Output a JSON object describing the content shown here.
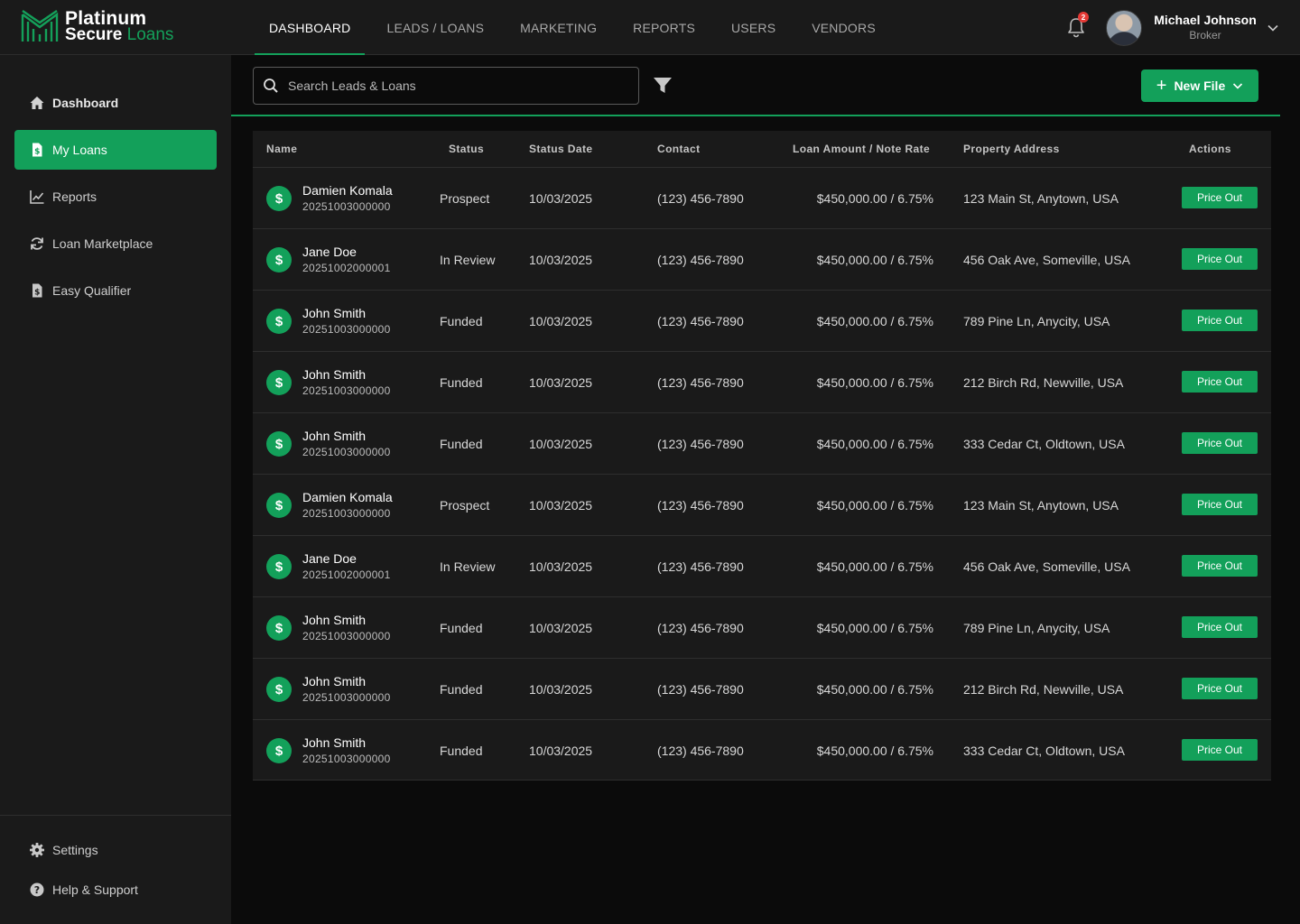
{
  "brand": {
    "line1": "Platinum",
    "line2_a": "Secure",
    "line2_b": "Loans",
    "accent": "#13a05a"
  },
  "nav": [
    {
      "label": "DASHBOARD",
      "active": true
    },
    {
      "label": "LEADS / LOANS"
    },
    {
      "label": "MARKETING"
    },
    {
      "label": "REPORTS"
    },
    {
      "label": "USERS"
    },
    {
      "label": "VENDORS"
    }
  ],
  "notifications": {
    "count": "2",
    "icon": "bell-icon"
  },
  "user": {
    "name": "Michael Johnson",
    "role": "Broker"
  },
  "sidebar": {
    "items": [
      {
        "label": "Dashboard",
        "icon": "home-icon"
      },
      {
        "label": "My Loans",
        "icon": "document-dollar-icon",
        "active": true
      },
      {
        "label": "Reports",
        "icon": "chart-line-icon"
      },
      {
        "label": "Loan Marketplace",
        "icon": "refresh-icon"
      },
      {
        "label": "Easy Qualifier",
        "icon": "document-dollar-icon"
      }
    ],
    "bottom": [
      {
        "label": "Settings",
        "icon": "gear-icon"
      },
      {
        "label": "Help & Support",
        "icon": "help-icon"
      }
    ]
  },
  "search": {
    "placeholder": "Search Leads & Loans",
    "value": ""
  },
  "toolbar": {
    "new_file_label": "New File"
  },
  "table": {
    "columns": [
      "Name",
      "Status",
      "Status Date",
      "Contact",
      "Loan Amount / Note Rate",
      "Property Address",
      "Actions"
    ],
    "rows": [
      {
        "name": "Damien Komala",
        "id": "20251003000000",
        "status": "Prospect",
        "date": "10/03/2025",
        "contact": "(123) 456-7890",
        "amount": "$450,000.00 / 6.75%",
        "address": "123 Main St, Anytown, USA",
        "action": "Price Out"
      },
      {
        "name": "Jane Doe",
        "id": "20251002000001",
        "status": "In Review",
        "date": "10/03/2025",
        "contact": "(123) 456-7890",
        "amount": "$450,000.00 / 6.75%",
        "address": "456 Oak Ave, Someville, USA",
        "action": "Price Out"
      },
      {
        "name": "John Smith",
        "id": "20251003000000",
        "status": "Funded",
        "date": "10/03/2025",
        "contact": "(123) 456-7890",
        "amount": "$450,000.00 / 6.75%",
        "address": "789 Pine Ln, Anycity, USA",
        "action": "Price Out"
      },
      {
        "name": "John Smith",
        "id": "20251003000000",
        "status": "Funded",
        "date": "10/03/2025",
        "contact": "(123) 456-7890",
        "amount": "$450,000.00 / 6.75%",
        "address": "212 Birch Rd, Newville, USA",
        "action": "Price Out"
      },
      {
        "name": "John Smith",
        "id": "20251003000000",
        "status": "Funded",
        "date": "10/03/2025",
        "contact": "(123) 456-7890",
        "amount": "$450,000.00 / 6.75%",
        "address": "333 Cedar Ct, Oldtown, USA",
        "action": "Price Out"
      },
      {
        "name": "Damien Komala",
        "id": "20251003000000",
        "status": "Prospect",
        "date": "10/03/2025",
        "contact": "(123) 456-7890",
        "amount": "$450,000.00 / 6.75%",
        "address": "123 Main St, Anytown, USA",
        "action": "Price Out"
      },
      {
        "name": "Jane Doe",
        "id": "20251002000001",
        "status": "In Review",
        "date": "10/03/2025",
        "contact": "(123) 456-7890",
        "amount": "$450,000.00 / 6.75%",
        "address": "456 Oak Ave, Someville, USA",
        "action": "Price Out"
      },
      {
        "name": "John Smith",
        "id": "20251003000000",
        "status": "Funded",
        "date": "10/03/2025",
        "contact": "(123) 456-7890",
        "amount": "$450,000.00 / 6.75%",
        "address": "789 Pine Ln, Anycity, USA",
        "action": "Price Out"
      },
      {
        "name": "John Smith",
        "id": "20251003000000",
        "status": "Funded",
        "date": "10/03/2025",
        "contact": "(123) 456-7890",
        "amount": "$450,000.00 / 6.75%",
        "address": "212 Birch Rd, Newville, USA",
        "action": "Price Out"
      },
      {
        "name": "John Smith",
        "id": "20251003000000",
        "status": "Funded",
        "date": "10/03/2025",
        "contact": "(123) 456-7890",
        "amount": "$450,000.00 / 6.75%",
        "address": "333 Cedar Ct, Oldtown, USA",
        "action": "Price Out"
      }
    ]
  }
}
